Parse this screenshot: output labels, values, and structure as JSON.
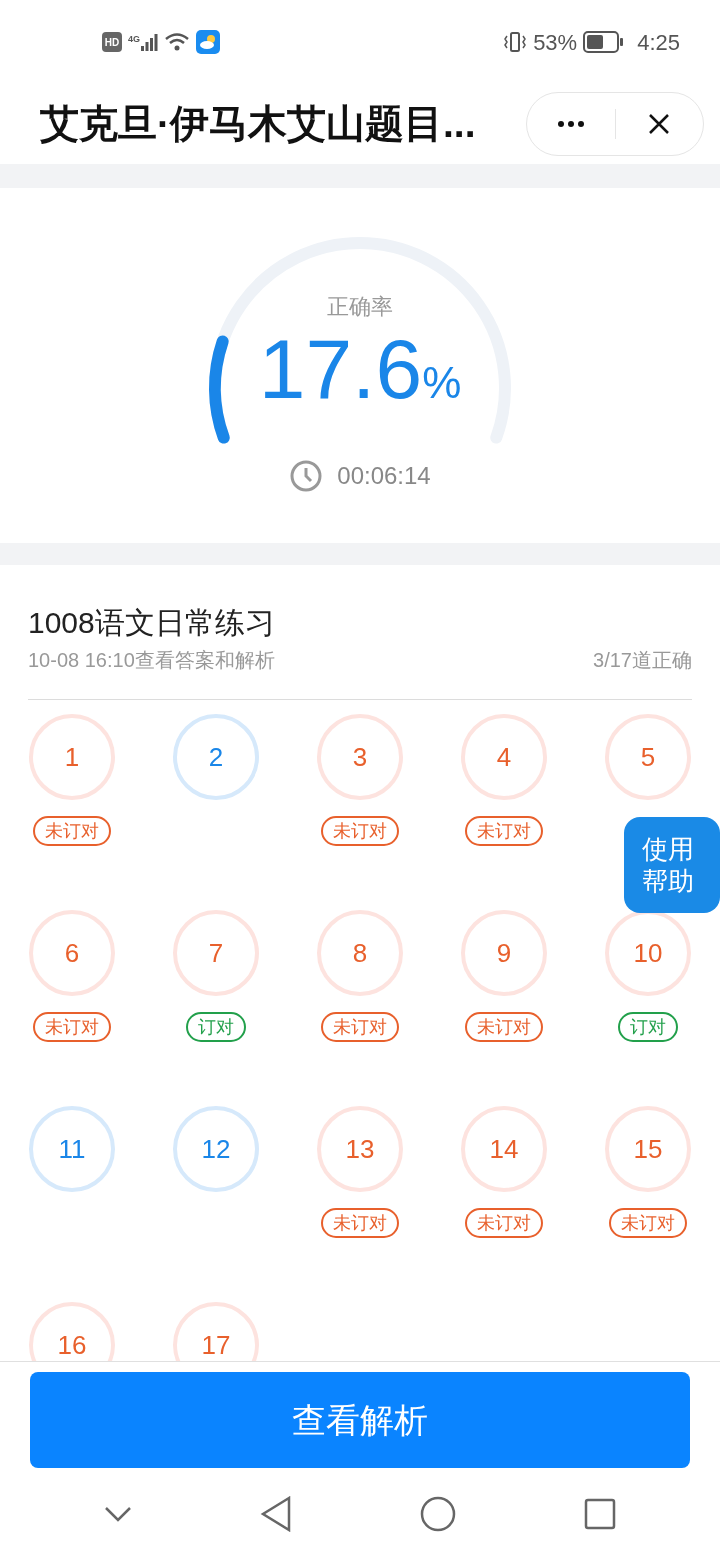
{
  "status_bar": {
    "hd": "HD",
    "network": "4G",
    "battery": "53%",
    "time": "4:25"
  },
  "header": {
    "title": "艾克旦·伊马木艾山题目..."
  },
  "summary": {
    "label": "正确率",
    "value": "17.6",
    "unit": "%",
    "duration": "00:06:14"
  },
  "exercise": {
    "title": "1008语文日常练习",
    "subtitle": "10-08 16:10查看答案和解析",
    "score": "3/17道正确"
  },
  "questions": [
    {
      "number": "1",
      "kind": "wrong",
      "tag": "未订对",
      "corrected": false
    },
    {
      "number": "2",
      "kind": "correct"
    },
    {
      "number": "3",
      "kind": "wrong",
      "tag": "未订对",
      "corrected": false
    },
    {
      "number": "4",
      "kind": "wrong",
      "tag": "未订对",
      "corrected": false
    },
    {
      "number": "5",
      "kind": "wrong"
    },
    {
      "number": "6",
      "kind": "wrong",
      "tag": "未订对",
      "corrected": false
    },
    {
      "number": "7",
      "kind": "wrong",
      "tag": "订对",
      "corrected": true
    },
    {
      "number": "8",
      "kind": "wrong",
      "tag": "未订对",
      "corrected": false
    },
    {
      "number": "9",
      "kind": "wrong",
      "tag": "未订对",
      "corrected": false
    },
    {
      "number": "10",
      "kind": "wrong",
      "tag": "订对",
      "corrected": true
    },
    {
      "number": "11",
      "kind": "correct"
    },
    {
      "number": "12",
      "kind": "correct"
    },
    {
      "number": "13",
      "kind": "wrong",
      "tag": "未订对",
      "corrected": false
    },
    {
      "number": "14",
      "kind": "wrong",
      "tag": "未订对",
      "corrected": false
    },
    {
      "number": "15",
      "kind": "wrong",
      "tag": "未订对",
      "corrected": false
    },
    {
      "number": "16",
      "kind": "wrong"
    },
    {
      "number": "17",
      "kind": "wrong"
    }
  ],
  "help_button": {
    "label": "使用帮助"
  },
  "primary_button": {
    "label": "查看解析"
  }
}
